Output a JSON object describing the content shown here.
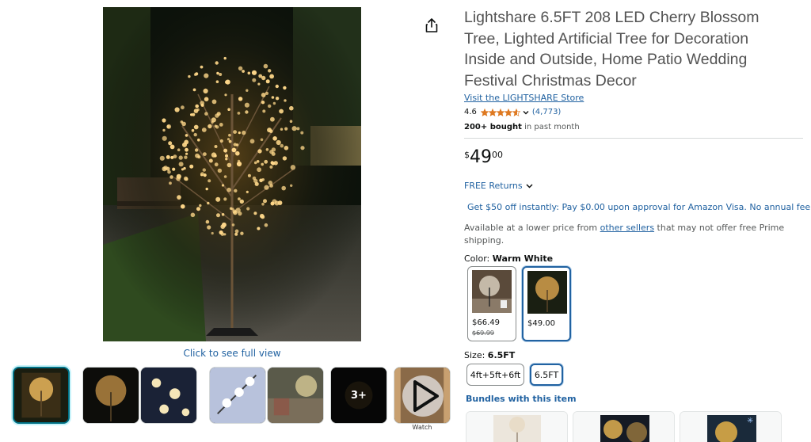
{
  "gallery": {
    "main_image_alt": "cherry-blossom-tree-photo",
    "click_to_see": "Click to see full view",
    "more_count": "3+",
    "watch_label": "Watch"
  },
  "product": {
    "title": "Lightshare 6.5FT 208 LED Cherry Blossom Tree, Lighted Artificial Tree for Decoration Inside and Outside, Home Patio Wedding Festival Christmas Decor",
    "store_link": "Visit the LIGHTSHARE Store",
    "rating": "4.6",
    "rating_stars": 4.6,
    "rating_count": "(4,773)",
    "bought_bold": "200+ bought",
    "bought_rest": " in past month"
  },
  "price": {
    "symbol": "$",
    "whole": "49",
    "fraction": "00"
  },
  "returns": {
    "label": "FREE Returns"
  },
  "promo": {
    "text": "Get $50 off instantly: Pay $0.00 upon approval for Amazon Visa. No annual fee."
  },
  "lower_price": {
    "before": "Available at a lower price from ",
    "link": "other sellers",
    "after": " that may not offer free Prime shipping."
  },
  "color": {
    "label": "Color: ",
    "selected": "Warm White",
    "options": [
      {
        "price": "$66.49",
        "old_price": "$69.99"
      },
      {
        "price": "$49.00"
      }
    ]
  },
  "size": {
    "label": "Size: ",
    "selected": "6.5FT",
    "options": [
      "4ft+5ft+6ft",
      "6.5FT"
    ]
  },
  "bundles": {
    "heading": "Bundles with this item"
  },
  "colors": {
    "link": "#2162a1",
    "star": "#de7921",
    "selected_border": "#2162a1",
    "thumb_selected": "#007185"
  }
}
